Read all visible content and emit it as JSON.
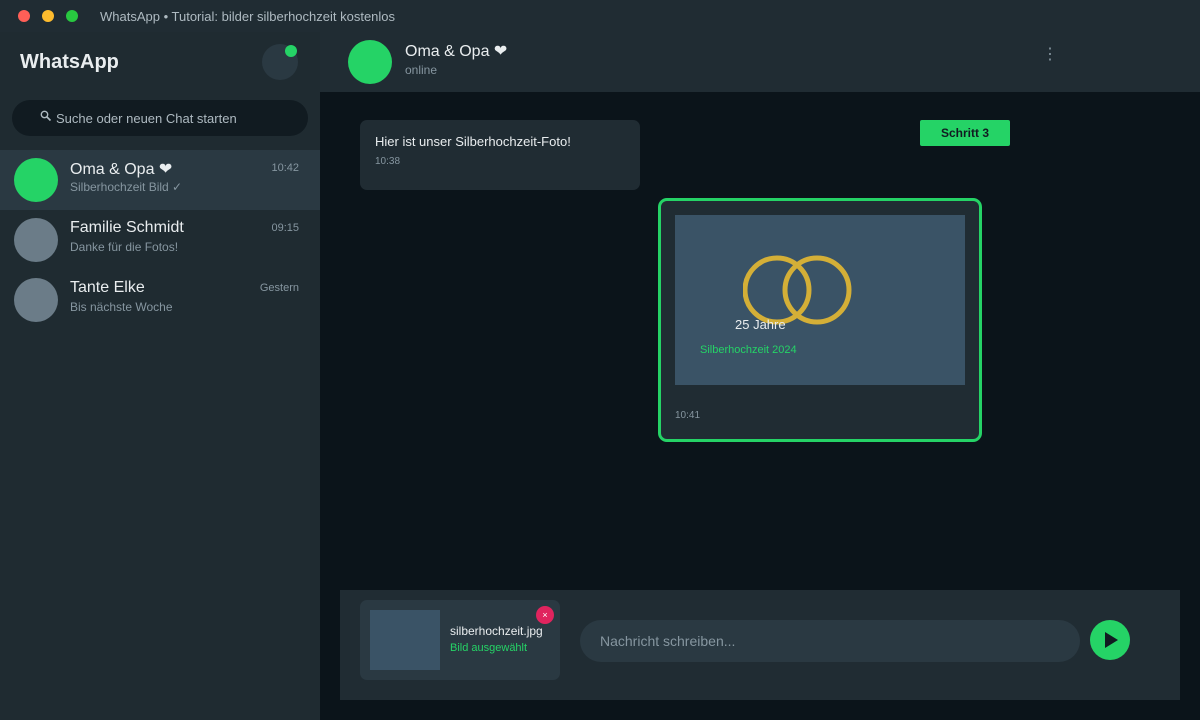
{
  "window": {
    "title": "WhatsApp • Tutorial: bilder silberhochzeit kostenlos"
  },
  "sidebar": {
    "title": "WhatsApp",
    "search": {
      "icon": "search-icon",
      "placeholder": "Suche oder neuen Chat starten",
      "value": ""
    },
    "chats": [
      {
        "name": "Oma & Opa ❤",
        "time": "10:42",
        "preview": "Silberhochzeit Bild ✓",
        "active": true
      },
      {
        "name": "Familie Schmidt",
        "time": "09:15",
        "preview": "Danke für die Fotos!"
      },
      {
        "name": "Tante Elke",
        "time": "Gestern",
        "preview": "Bis nächste Woche"
      }
    ]
  },
  "chat": {
    "name": "Oma & Opa ❤",
    "status": "online",
    "menu_icon": "⋮",
    "messages": [
      {
        "text": "Hier ist unser Silberhochzeit-Foto!",
        "time": "10:38"
      }
    ],
    "step_badge": "Schritt 3",
    "photo_message": {
      "years": "25 Jahre",
      "caption": "Silberhochzeit 2024",
      "time": "10:41"
    }
  },
  "composer": {
    "attachment": {
      "filename": "silberhochzeit.jpg",
      "status": "Bild ausgewählt",
      "remove": "×"
    },
    "placeholder": "Nachricht schreiben...",
    "value": "",
    "send_icon": "send-icon"
  },
  "colors": {
    "accent": "#25d366",
    "panel": "#202c33",
    "background": "#0b141a",
    "ring_gold": "#d4af37",
    "remove_red": "#e0245e"
  }
}
